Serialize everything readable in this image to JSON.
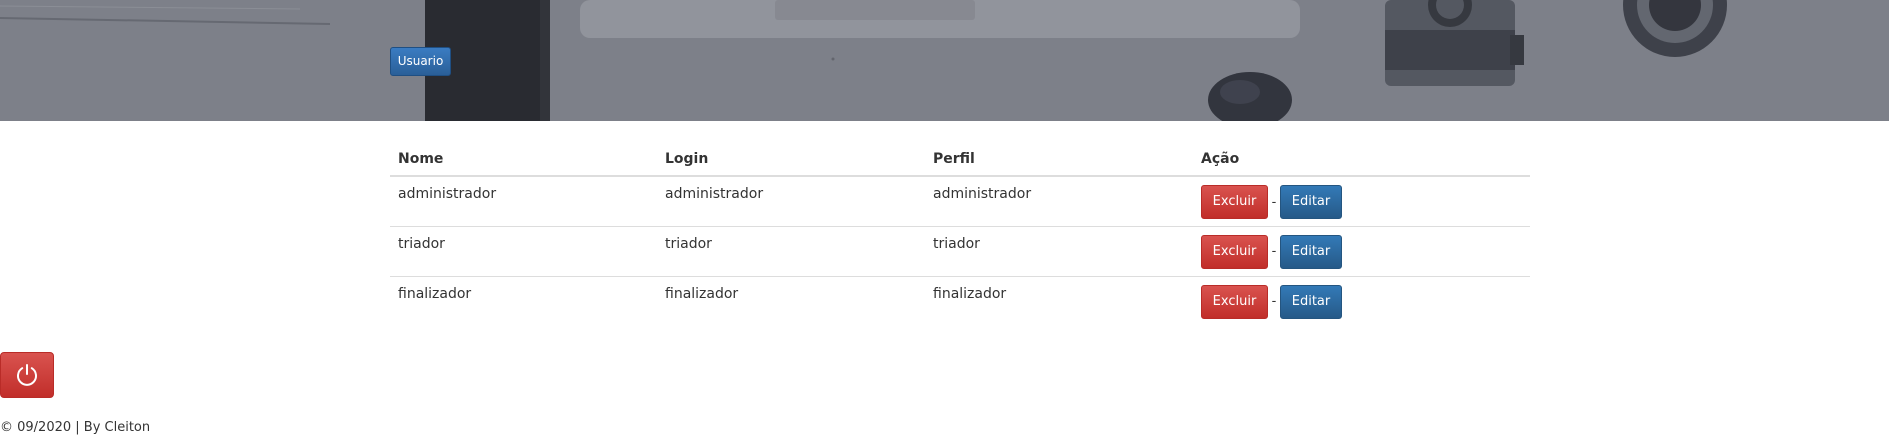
{
  "header": {
    "usuario_button": "Usuario"
  },
  "table": {
    "columns": [
      "Nome",
      "Login",
      "Perfil",
      "Ação"
    ],
    "rows": [
      {
        "nome": "administrador",
        "login": "administrador",
        "perfil": "administrador"
      },
      {
        "nome": "triador",
        "login": "triador",
        "perfil": "triador"
      },
      {
        "nome": "finalizador",
        "login": "finalizador",
        "perfil": "finalizador"
      }
    ],
    "delete_label": "Excluir",
    "edit_label": "Editar",
    "separator": "-"
  },
  "logout": {
    "icon": "power-icon"
  },
  "footer": {
    "text": "© 09/2020 | By Cleiton"
  },
  "colors": {
    "danger": "#d9534f",
    "primary": "#337ab7"
  }
}
